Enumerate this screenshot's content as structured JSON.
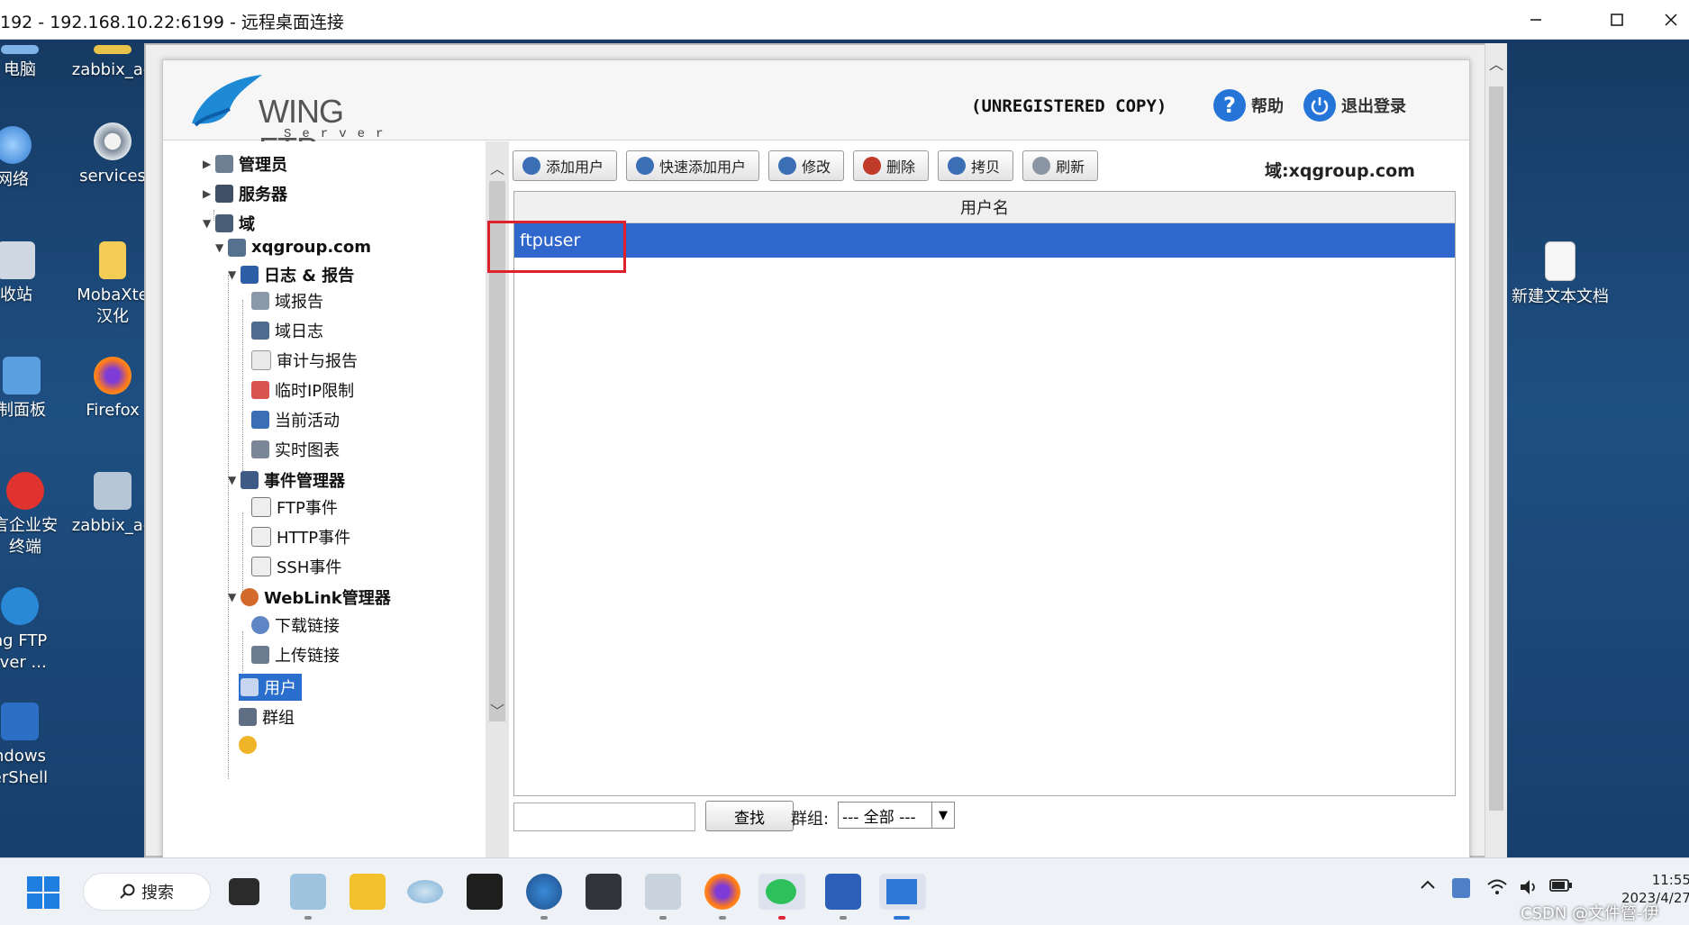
{
  "window": {
    "title": "192 - 192.168.10.22:6199 - 远程桌面连接"
  },
  "desktop": {
    "icons_left": [
      {
        "label": "电脑"
      },
      {
        "label": "网络"
      },
      {
        "label": "收站"
      },
      {
        "label": "制面板"
      },
      {
        "label": "言企业安",
        "label2": "终端"
      },
      {
        "label": "ng FTP",
        "label2": "rver ..."
      },
      {
        "label": "ndows",
        "label2": "erShell"
      }
    ],
    "icons_col2": [
      {
        "label": "zabbix_ag"
      },
      {
        "label": "services"
      },
      {
        "label": "MobaXte",
        "label2": "汉化"
      },
      {
        "label": "Firefox"
      },
      {
        "label": "zabbix_ag"
      }
    ],
    "icons_right": [
      {
        "label": "新建文本文档"
      }
    ]
  },
  "app": {
    "logo": {
      "name": "WING FTP",
      "sub": "Server"
    },
    "unregistered": "(UNREGISTERED COPY)",
    "help_label": "帮助",
    "logout_label": "退出登录",
    "tree": [
      {
        "label": "管理员",
        "level": 0,
        "expanded": false
      },
      {
        "label": "服务器",
        "level": 0,
        "expanded": false
      },
      {
        "label": "域",
        "level": 0,
        "expanded": true
      },
      {
        "label": "xqgroup.com",
        "level": 1,
        "expanded": true
      },
      {
        "label": "日志 & 报告",
        "level": 2,
        "expanded": true
      },
      {
        "label": "域报告",
        "level": 3
      },
      {
        "label": "域日志",
        "level": 3
      },
      {
        "label": "审计与报告",
        "level": 3
      },
      {
        "label": "临时IP限制",
        "level": 3
      },
      {
        "label": "当前活动",
        "level": 3
      },
      {
        "label": "实时图表",
        "level": 3
      },
      {
        "label": "事件管理器",
        "level": 2,
        "expanded": true
      },
      {
        "label": "FTP事件",
        "level": 3
      },
      {
        "label": "HTTP事件",
        "level": 3
      },
      {
        "label": "SSH事件",
        "level": 3
      },
      {
        "label": "WebLink管理器",
        "level": 2,
        "expanded": true
      },
      {
        "label": "下载链接",
        "level": 3
      },
      {
        "label": "上传链接",
        "level": 3
      },
      {
        "label": "用户",
        "level": 2,
        "selected": true
      },
      {
        "label": "群组",
        "level": 2
      }
    ],
    "toolbar": [
      "添加用户",
      "快速添加用户",
      "修改",
      "删除",
      "拷贝",
      "刷新"
    ],
    "domain_label": "域:xqgroup.com",
    "table": {
      "column": "用户名",
      "rows": [
        "ftpuser"
      ]
    },
    "search": {
      "value": "",
      "button": "查找"
    },
    "group": {
      "label": "群组:",
      "value": "--- 全部 ---"
    }
  },
  "taskbar": {
    "search_label": "搜索",
    "clock_time": "11:55",
    "clock_date": "2023/4/27"
  },
  "watermark": "CSDN @文件管-伊"
}
